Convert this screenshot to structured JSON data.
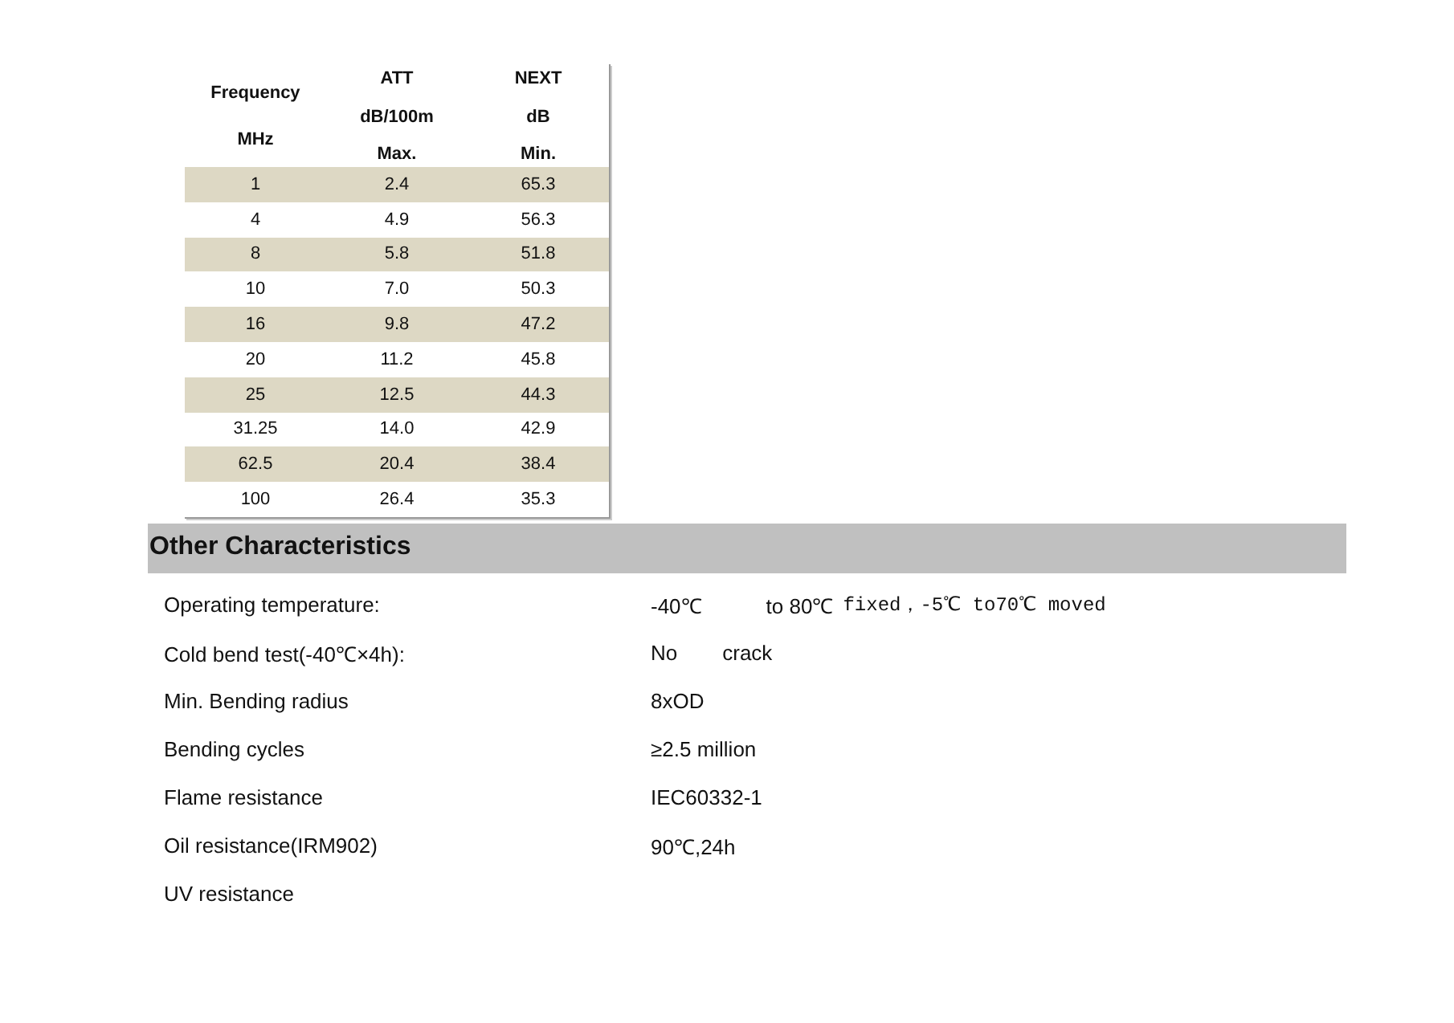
{
  "table": {
    "columns": [
      {
        "lines": [
          "Frequency",
          "MHz"
        ]
      },
      {
        "lines": [
          "ATT",
          "dB/100m",
          "Max."
        ]
      },
      {
        "lines": [
          "NEXT",
          "dB",
          "Min."
        ]
      }
    ],
    "rows": [
      [
        "1",
        "2.4",
        "65.3"
      ],
      [
        "4",
        "4.9",
        "56.3"
      ],
      [
        "8",
        "5.8",
        "51.8"
      ],
      [
        "10",
        "7.0",
        "50.3"
      ],
      [
        "16",
        "9.8",
        "47.2"
      ],
      [
        "20",
        "11.2",
        "45.8"
      ],
      [
        "25",
        "12.5",
        "44.3"
      ],
      [
        "31.25",
        "14.0",
        "42.9"
      ],
      [
        "62.5",
        "20.4",
        "38.4"
      ],
      [
        "100",
        "26.4",
        "35.3"
      ]
    ]
  },
  "section": {
    "title": "Other Characteristics",
    "items": [
      {
        "label": "Operating temperature:",
        "values": [
          {
            "kind": "sans",
            "text": "-40℃"
          },
          {
            "kind": "sans",
            "text": "to 80℃"
          },
          {
            "kind": "mono",
            "text": "fixed，-5℃ to70℃ moved"
          }
        ]
      },
      {
        "label": "Cold bend test(-40℃×4h):",
        "values": [
          {
            "kind": "sans",
            "text": "No"
          },
          {
            "kind": "sans",
            "text": "crack"
          }
        ]
      },
      {
        "label": "Min. Bending radius",
        "values": [
          {
            "kind": "sans",
            "text": "8xOD"
          }
        ]
      },
      {
        "label": "Bending cycles",
        "values": [
          {
            "kind": "sans",
            "text": "≥2.5 million"
          }
        ]
      },
      {
        "label": "Flame resistance",
        "values": [
          {
            "kind": "sans",
            "text": "IEC60332-1"
          }
        ]
      },
      {
        "label": "Oil resistance(IRM902)",
        "values": [
          {
            "kind": "sans",
            "text": "90℃,24h"
          }
        ]
      },
      {
        "label": "UV resistance"
      }
    ]
  }
}
